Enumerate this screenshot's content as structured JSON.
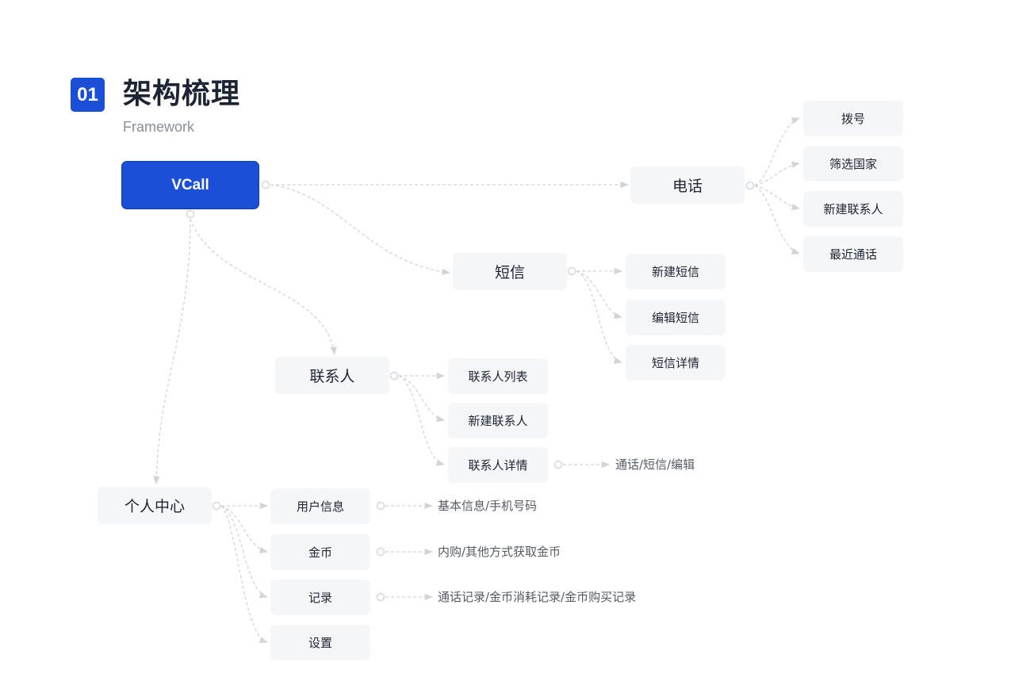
{
  "header": {
    "number": "01",
    "title": "架构梳理",
    "subtitle": "Framework"
  },
  "root": {
    "label": "VCall"
  },
  "phone": {
    "label": "电话",
    "children": [
      "拨号",
      "筛选国家",
      "新建联系人",
      "最近通话"
    ]
  },
  "sms": {
    "label": "短信",
    "children": [
      "新建短信",
      "编辑短信",
      "短信详情"
    ]
  },
  "contacts": {
    "label": "联系人",
    "children": [
      "联系人列表",
      "新建联系人",
      "联系人详情"
    ],
    "detail_note": "通话/短信/编辑"
  },
  "personal": {
    "label": "个人中心",
    "children": [
      "用户信息",
      "金币",
      "记录",
      "设置"
    ],
    "notes": [
      "基本信息/手机号码",
      "内购/其他方式获取金币",
      "通话记录/金币消耗记录/金币购买记录"
    ]
  },
  "colors": {
    "accent": "#1a4fd6",
    "node_bg": "#f5f6f8",
    "connector": "#d2d4d8"
  }
}
